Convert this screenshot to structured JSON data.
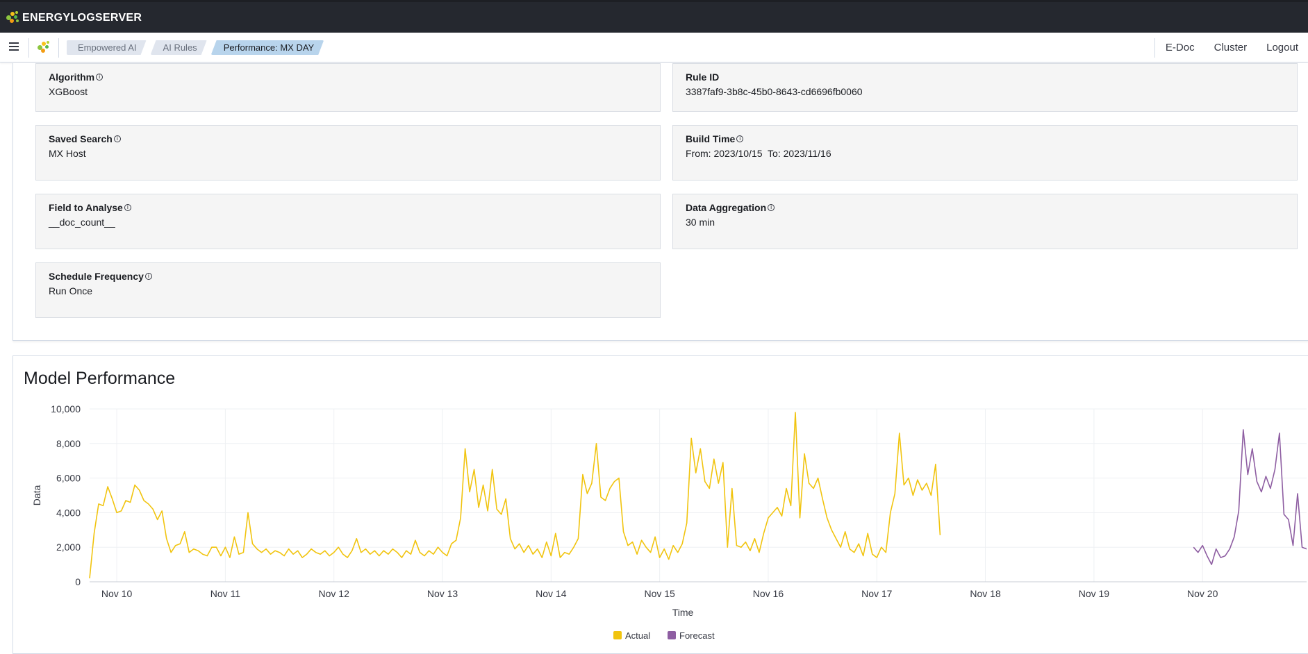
{
  "app": {
    "brand": "ENERGYLOGSERVER"
  },
  "breadcrumbs": [
    {
      "label": "Empowered AI"
    },
    {
      "label": "AI Rules"
    },
    {
      "label": "Performance: MX DAY"
    }
  ],
  "nav_links": [
    {
      "label": "E-Doc"
    },
    {
      "label": "Cluster"
    },
    {
      "label": "Logout"
    }
  ],
  "details": {
    "algorithm": {
      "label": "Algorithm",
      "value": "XGBoost"
    },
    "rule_id": {
      "label": "Rule ID",
      "value": "3387faf9-3b8c-45b0-8643-cd6696fb0060"
    },
    "saved_search": {
      "label": "Saved Search",
      "value": "MX Host"
    },
    "build_time": {
      "label": "Build Time",
      "value": "From: 2023/10/15  To: 2023/11/16"
    },
    "field_to_analyse": {
      "label": "Field to Analyse",
      "value": "__doc_count__"
    },
    "data_aggregation": {
      "label": "Data Aggregation",
      "value": "30 min"
    },
    "schedule_frequency": {
      "label": "Schedule Frequency",
      "value": "Run Once"
    }
  },
  "model_performance": {
    "title": "Model Performance"
  },
  "colors": {
    "actual": "#f1c40f",
    "forecast": "#8e5ea2",
    "topbar": "#25282f",
    "crumb_active": "#b8d4ec"
  },
  "chart_data": {
    "type": "line",
    "xlabel": "Time",
    "ylabel": "Data",
    "ylim": [
      0,
      10000
    ],
    "xlim": [
      "Nov 9 18:00",
      "Nov 20 23:00"
    ],
    "yticks": [
      "0",
      "2,000",
      "4,000",
      "6,000",
      "8,000",
      "10,000"
    ],
    "xticks": [
      "Nov 10",
      "Nov 11",
      "Nov 12",
      "Nov 13",
      "Nov 14",
      "Nov 15",
      "Nov 16",
      "Nov 17",
      "Nov 18",
      "Nov 19",
      "Nov 20"
    ],
    "grid": true,
    "legend": "bottom-center",
    "series": [
      {
        "name": "Actual",
        "color": "#f1c40f",
        "points": [
          [
            "Nov 9 18:00",
            200
          ],
          [
            "Nov 9 19:00",
            2800
          ],
          [
            "Nov 9 20:00",
            4500
          ],
          [
            "Nov 9 21:00",
            4400
          ],
          [
            "Nov 9 22:00",
            5500
          ],
          [
            "Nov 9 23:00",
            4800
          ],
          [
            "Nov 10 00:00",
            4000
          ],
          [
            "Nov 10 01:00",
            4100
          ],
          [
            "Nov 10 02:00",
            4700
          ],
          [
            "Nov 10 03:00",
            4600
          ],
          [
            "Nov 10 04:00",
            5600
          ],
          [
            "Nov 10 05:00",
            5300
          ],
          [
            "Nov 10 06:00",
            4700
          ],
          [
            "Nov 10 07:00",
            4500
          ],
          [
            "Nov 10 08:00",
            4200
          ],
          [
            "Nov 10 09:00",
            3600
          ],
          [
            "Nov 10 10:00",
            4100
          ],
          [
            "Nov 10 11:00",
            2500
          ],
          [
            "Nov 10 12:00",
            1700
          ],
          [
            "Nov 10 13:00",
            2100
          ],
          [
            "Nov 10 14:00",
            2200
          ],
          [
            "Nov 10 15:00",
            2900
          ],
          [
            "Nov 10 16:00",
            1700
          ],
          [
            "Nov 10 17:00",
            1900
          ],
          [
            "Nov 10 18:00",
            1800
          ],
          [
            "Nov 10 19:00",
            1600
          ],
          [
            "Nov 10 20:00",
            1500
          ],
          [
            "Nov 10 21:00",
            2000
          ],
          [
            "Nov 10 22:00",
            2000
          ],
          [
            "Nov 10 23:00",
            1500
          ],
          [
            "Nov 11 00:00",
            2000
          ],
          [
            "Nov 11 01:00",
            1400
          ],
          [
            "Nov 11 02:00",
            2600
          ],
          [
            "Nov 11 03:00",
            1600
          ],
          [
            "Nov 11 04:00",
            1700
          ],
          [
            "Nov 11 05:00",
            4000
          ],
          [
            "Nov 11 06:00",
            2200
          ],
          [
            "Nov 11 07:00",
            1900
          ],
          [
            "Nov 11 08:00",
            1700
          ],
          [
            "Nov 11 09:00",
            1900
          ],
          [
            "Nov 11 10:00",
            1600
          ],
          [
            "Nov 11 11:00",
            1800
          ],
          [
            "Nov 11 12:00",
            1700
          ],
          [
            "Nov 11 13:00",
            1500
          ],
          [
            "Nov 11 14:00",
            1900
          ],
          [
            "Nov 11 15:00",
            1600
          ],
          [
            "Nov 11 16:00",
            1800
          ],
          [
            "Nov 11 17:00",
            1400
          ],
          [
            "Nov 11 18:00",
            1600
          ],
          [
            "Nov 11 19:00",
            1900
          ],
          [
            "Nov 11 20:00",
            1700
          ],
          [
            "Nov 11 21:00",
            1600
          ],
          [
            "Nov 11 22:00",
            1800
          ],
          [
            "Nov 11 23:00",
            1500
          ],
          [
            "Nov 12 00:00",
            1700
          ],
          [
            "Nov 12 01:00",
            2000
          ],
          [
            "Nov 12 02:00",
            1600
          ],
          [
            "Nov 12 03:00",
            1400
          ],
          [
            "Nov 12 04:00",
            1800
          ],
          [
            "Nov 12 05:00",
            2500
          ],
          [
            "Nov 12 06:00",
            1700
          ],
          [
            "Nov 12 07:00",
            1900
          ],
          [
            "Nov 12 08:00",
            1600
          ],
          [
            "Nov 12 09:00",
            1800
          ],
          [
            "Nov 12 10:00",
            1500
          ],
          [
            "Nov 12 11:00",
            1800
          ],
          [
            "Nov 12 12:00",
            1600
          ],
          [
            "Nov 12 13:00",
            1900
          ],
          [
            "Nov 12 14:00",
            1700
          ],
          [
            "Nov 12 15:00",
            1400
          ],
          [
            "Nov 12 16:00",
            1800
          ],
          [
            "Nov 12 17:00",
            1600
          ],
          [
            "Nov 12 18:00",
            2400
          ],
          [
            "Nov 12 19:00",
            1700
          ],
          [
            "Nov 12 20:00",
            1500
          ],
          [
            "Nov 12 21:00",
            1800
          ],
          [
            "Nov 12 22:00",
            1600
          ],
          [
            "Nov 12 23:00",
            2000
          ],
          [
            "Nov 13 00:00",
            1700
          ],
          [
            "Nov 13 01:00",
            1500
          ],
          [
            "Nov 13 02:00",
            2200
          ],
          [
            "Nov 13 03:00",
            2400
          ],
          [
            "Nov 13 04:00",
            3700
          ],
          [
            "Nov 13 05:00",
            7700
          ],
          [
            "Nov 13 06:00",
            5200
          ],
          [
            "Nov 13 07:00",
            6500
          ],
          [
            "Nov 13 08:00",
            4300
          ],
          [
            "Nov 13 09:00",
            5600
          ],
          [
            "Nov 13 10:00",
            4100
          ],
          [
            "Nov 13 11:00",
            6500
          ],
          [
            "Nov 13 12:00",
            4200
          ],
          [
            "Nov 13 13:00",
            3900
          ],
          [
            "Nov 13 14:00",
            4800
          ],
          [
            "Nov 13 15:00",
            2500
          ],
          [
            "Nov 13 16:00",
            1900
          ],
          [
            "Nov 13 17:00",
            2200
          ],
          [
            "Nov 13 18:00",
            1700
          ],
          [
            "Nov 13 19:00",
            2100
          ],
          [
            "Nov 13 20:00",
            1600
          ],
          [
            "Nov 13 21:00",
            1900
          ],
          [
            "Nov 13 22:00",
            1400
          ],
          [
            "Nov 13 23:00",
            2300
          ],
          [
            "Nov 14 00:00",
            1500
          ],
          [
            "Nov 14 01:00",
            2800
          ],
          [
            "Nov 14 02:00",
            1400
          ],
          [
            "Nov 14 03:00",
            1700
          ],
          [
            "Nov 14 04:00",
            1600
          ],
          [
            "Nov 14 05:00",
            2000
          ],
          [
            "Nov 14 06:00",
            2500
          ],
          [
            "Nov 14 07:00",
            6200
          ],
          [
            "Nov 14 08:00",
            5100
          ],
          [
            "Nov 14 09:00",
            5700
          ],
          [
            "Nov 14 10:00",
            8000
          ],
          [
            "Nov 14 11:00",
            4900
          ],
          [
            "Nov 14 12:00",
            4700
          ],
          [
            "Nov 14 13:00",
            5400
          ],
          [
            "Nov 14 14:00",
            5800
          ],
          [
            "Nov 14 15:00",
            6000
          ],
          [
            "Nov 14 16:00",
            2900
          ],
          [
            "Nov 14 17:00",
            2100
          ],
          [
            "Nov 14 18:00",
            2300
          ],
          [
            "Nov 14 19:00",
            1600
          ],
          [
            "Nov 14 20:00",
            2400
          ],
          [
            "Nov 14 21:00",
            2000
          ],
          [
            "Nov 14 22:00",
            1700
          ],
          [
            "Nov 14 23:00",
            2600
          ],
          [
            "Nov 15 00:00",
            1400
          ],
          [
            "Nov 15 01:00",
            1900
          ],
          [
            "Nov 15 02:00",
            1300
          ],
          [
            "Nov 15 03:00",
            2100
          ],
          [
            "Nov 15 04:00",
            1700
          ],
          [
            "Nov 15 05:00",
            2200
          ],
          [
            "Nov 15 06:00",
            3400
          ],
          [
            "Nov 15 07:00",
            8300
          ],
          [
            "Nov 15 08:00",
            6300
          ],
          [
            "Nov 15 09:00",
            7700
          ],
          [
            "Nov 15 10:00",
            5800
          ],
          [
            "Nov 15 11:00",
            5400
          ],
          [
            "Nov 15 12:00",
            7100
          ],
          [
            "Nov 15 13:00",
            5700
          ],
          [
            "Nov 15 14:00",
            6900
          ],
          [
            "Nov 15 15:00",
            2000
          ],
          [
            "Nov 15 16:00",
            5400
          ],
          [
            "Nov 15 17:00",
            2100
          ],
          [
            "Nov 15 18:00",
            2000
          ],
          [
            "Nov 15 19:00",
            2300
          ],
          [
            "Nov 15 20:00",
            1800
          ],
          [
            "Nov 15 21:00",
            2500
          ],
          [
            "Nov 15 22:00",
            1700
          ],
          [
            "Nov 15 23:00",
            2800
          ],
          [
            "Nov 16 00:00",
            3700
          ],
          [
            "Nov 16 01:00",
            4000
          ],
          [
            "Nov 16 02:00",
            4300
          ],
          [
            "Nov 16 03:00",
            3800
          ],
          [
            "Nov 16 04:00",
            5400
          ],
          [
            "Nov 16 05:00",
            4400
          ],
          [
            "Nov 16 06:00",
            9800
          ],
          [
            "Nov 16 07:00",
            3700
          ],
          [
            "Nov 16 08:00",
            7400
          ],
          [
            "Nov 16 09:00",
            5700
          ],
          [
            "Nov 16 10:00",
            5400
          ],
          [
            "Nov 16 11:00",
            6000
          ],
          [
            "Nov 16 12:00",
            4800
          ],
          [
            "Nov 16 13:00",
            3700
          ],
          [
            "Nov 16 14:00",
            3000
          ],
          [
            "Nov 16 15:00",
            2500
          ],
          [
            "Nov 16 16:00",
            2000
          ],
          [
            "Nov 16 17:00",
            2900
          ],
          [
            "Nov 16 18:00",
            1900
          ],
          [
            "Nov 16 19:00",
            1700
          ],
          [
            "Nov 16 20:00",
            2200
          ],
          [
            "Nov 16 21:00",
            1500
          ],
          [
            "Nov 16 22:00",
            2800
          ],
          [
            "Nov 16 23:00",
            1600
          ],
          [
            "Nov 17 00:00",
            1400
          ],
          [
            "Nov 17 01:00",
            2000
          ],
          [
            "Nov 17 02:00",
            1700
          ],
          [
            "Nov 17 03:00",
            4000
          ],
          [
            "Nov 17 04:00",
            5100
          ],
          [
            "Nov 17 05:00",
            8600
          ],
          [
            "Nov 17 06:00",
            5600
          ],
          [
            "Nov 17 07:00",
            6000
          ],
          [
            "Nov 17 08:00",
            5000
          ],
          [
            "Nov 17 09:00",
            5900
          ],
          [
            "Nov 17 10:00",
            5300
          ],
          [
            "Nov 17 11:00",
            5700
          ],
          [
            "Nov 17 12:00",
            5000
          ],
          [
            "Nov 17 13:00",
            6800
          ],
          [
            "Nov 17 14:00",
            2700
          ]
        ]
      },
      {
        "name": "Forecast",
        "color": "#8e5ea2",
        "points": [
          [
            "Nov 19 22:00",
            2000
          ],
          [
            "Nov 19 23:00",
            1700
          ],
          [
            "Nov 20 00:00",
            2100
          ],
          [
            "Nov 20 01:00",
            1500
          ],
          [
            "Nov 20 02:00",
            1000
          ],
          [
            "Nov 20 03:00",
            1900
          ],
          [
            "Nov 20 04:00",
            1400
          ],
          [
            "Nov 20 05:00",
            1500
          ],
          [
            "Nov 20 06:00",
            1900
          ],
          [
            "Nov 20 07:00",
            2600
          ],
          [
            "Nov 20 08:00",
            4100
          ],
          [
            "Nov 20 09:00",
            8800
          ],
          [
            "Nov 20 10:00",
            6200
          ],
          [
            "Nov 20 11:00",
            7700
          ],
          [
            "Nov 20 12:00",
            5800
          ],
          [
            "Nov 20 13:00",
            5200
          ],
          [
            "Nov 20 14:00",
            6100
          ],
          [
            "Nov 20 15:00",
            5400
          ],
          [
            "Nov 20 16:00",
            6500
          ],
          [
            "Nov 20 17:00",
            8600
          ],
          [
            "Nov 20 18:00",
            3900
          ],
          [
            "Nov 20 19:00",
            3600
          ],
          [
            "Nov 20 20:00",
            2100
          ],
          [
            "Nov 20 21:00",
            5100
          ],
          [
            "Nov 20 22:00",
            2000
          ],
          [
            "Nov 20 23:00",
            1900
          ]
        ]
      }
    ]
  }
}
